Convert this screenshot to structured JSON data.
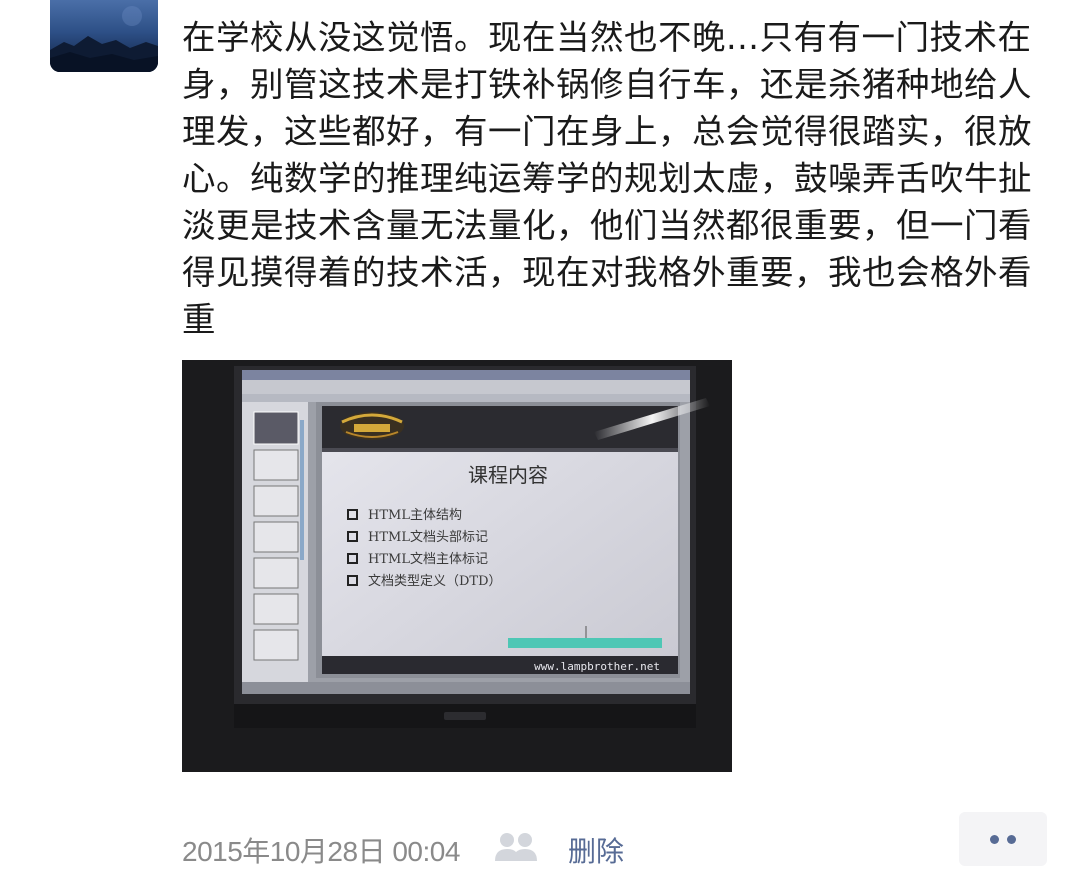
{
  "post": {
    "text": "在学校从没这觉悟。现在当然也不晚...只有有一门技术在身，别管这技术是打铁补锅修自行车，还是杀猪种地给人理发，这些都好，有一门在身上，总会觉得很踏实，很放心。纯数学的推理纯运筹学的规划太虚，鼓噪弄舌吹牛扯淡更是技术含量无法量化，他们当然都很重要，但一门看得见摸得着的技术活，现在对我格外重要，我也会格外看重"
  },
  "photo": {
    "slide_title": "课程内容",
    "bullets": [
      "HTML主体结构",
      "HTML文档头部标记",
      "HTML文档主体标记",
      "文档类型定义（DTD）"
    ],
    "url_text": "www.lampbrother.net"
  },
  "footer": {
    "timestamp": "2015年10月28日 00:04",
    "delete_label": "删除",
    "visibility_icon": "friends-icon"
  },
  "colors": {
    "link": "#576b95",
    "meta": "#8a8a8a",
    "text": "#1a1a1a",
    "more_bg": "#f4f4f6"
  }
}
